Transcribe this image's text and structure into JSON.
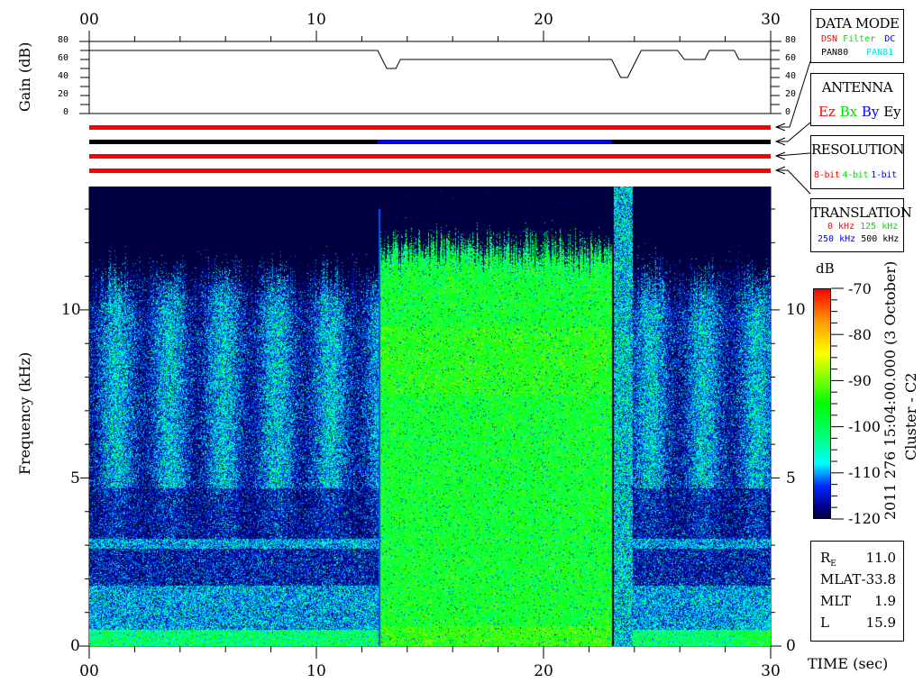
{
  "chart_data": {
    "type": "heatmap",
    "title": "Cluster - C2",
    "subtitle": "2011 276 15:04:00.000 (3 October)",
    "xlabel": "TIME (sec)",
    "ylabel": "Frequency (kHz)",
    "xlim": [
      0,
      30
    ],
    "ylim": [
      0,
      13.67
    ],
    "x_ticks": [
      "00",
      "10",
      "20",
      "30"
    ],
    "x_tick_values": [
      0,
      10,
      20,
      30
    ],
    "y_ticks": [
      "0",
      "5",
      "10"
    ],
    "y_tick_values": [
      0,
      5,
      10
    ],
    "colorbar": {
      "label": "dB",
      "range": [
        -120,
        -70
      ],
      "ticks": [
        "-70",
        "-80",
        "-90",
        "-100",
        "-110",
        "-120"
      ]
    },
    "regions": [
      {
        "t_start": 0,
        "t_end": 12.7,
        "upper_freq_khz": 11.0,
        "mean_db": -110
      },
      {
        "t_start": 12.7,
        "t_end": 23.0,
        "upper_freq_khz": 11.8,
        "mean_db": -96
      },
      {
        "t_start": 23.0,
        "t_end": 30,
        "upper_freq_khz": 11.0,
        "mean_db": -110
      }
    ],
    "gain": {
      "ylabel": "Gain (dB)",
      "ylim": [
        0,
        80
      ],
      "y_ticks": [
        "80",
        "60",
        "40",
        "20",
        "0"
      ],
      "points": [
        [
          0,
          70
        ],
        [
          12.7,
          70
        ],
        [
          13.1,
          50
        ],
        [
          13.5,
          50
        ],
        [
          13.7,
          60
        ],
        [
          23.0,
          60
        ],
        [
          23.4,
          40
        ],
        [
          23.7,
          40
        ],
        [
          24.3,
          70
        ],
        [
          25.9,
          70
        ],
        [
          26.2,
          60
        ],
        [
          27.1,
          60
        ],
        [
          27.3,
          70
        ],
        [
          28.4,
          70
        ],
        [
          28.6,
          60
        ],
        [
          30,
          60
        ]
      ]
    },
    "status_bars": [
      {
        "name": "data-mode",
        "segments": [
          {
            "t_start": 0,
            "t_end": 30,
            "color": "#ff0000"
          }
        ]
      },
      {
        "name": "antenna",
        "segments": [
          {
            "t_start": 0,
            "t_end": 12.7,
            "color": "#000000"
          },
          {
            "t_start": 12.7,
            "t_end": 23.0,
            "color": "#0000ff"
          },
          {
            "t_start": 23.0,
            "t_end": 30,
            "color": "#000000"
          }
        ]
      },
      {
        "name": "resolution",
        "segments": [
          {
            "t_start": 0,
            "t_end": 30,
            "color": "#ff0000"
          }
        ]
      },
      {
        "name": "translation",
        "segments": [
          {
            "t_start": 0,
            "t_end": 30,
            "color": "#ff0000"
          }
        ]
      }
    ]
  },
  "legend": {
    "data_mode": {
      "title": "DATA MODE",
      "items": [
        {
          "label": "DSN",
          "color": "#ff0000"
        },
        {
          "label": "Filter",
          "color": "#00e000"
        },
        {
          "label": "DC",
          "color": "#0000ff"
        },
        {
          "label": "PAN80",
          "color": "#000000"
        },
        {
          "label": "PAN81",
          "color": "#00e0e0"
        }
      ]
    },
    "antenna": {
      "title": "ANTENNA",
      "items": [
        {
          "label": "Ez",
          "color": "#ff0000"
        },
        {
          "label": "Bx",
          "color": "#00e000"
        },
        {
          "label": "By",
          "color": "#0000ff"
        },
        {
          "label": "Ey",
          "color": "#000000"
        }
      ]
    },
    "resolution": {
      "title": "RESOLUTION",
      "items": [
        {
          "label": "8-bit",
          "color": "#ff0000"
        },
        {
          "label": "4-bit",
          "color": "#00e000"
        },
        {
          "label": "1-bit",
          "color": "#0000ff"
        }
      ]
    },
    "translation": {
      "title": "TRANSLATION",
      "items": [
        {
          "label": "0 kHz",
          "color": "#ff0000"
        },
        {
          "label": "125 kHz",
          "color": "#00e000"
        },
        {
          "label": "250 kHz",
          "color": "#0000ff"
        },
        {
          "label": "500 kHz",
          "color": "#000000"
        }
      ]
    }
  },
  "ephemeris": [
    {
      "label": "R",
      "sub": "E",
      "value": "11.0"
    },
    {
      "label": "MLAT",
      "sub": "",
      "value": "-33.8"
    },
    {
      "label": "MLT",
      "sub": "",
      "value": "1.9"
    },
    {
      "label": "L",
      "sub": "",
      "value": "15.9"
    }
  ]
}
